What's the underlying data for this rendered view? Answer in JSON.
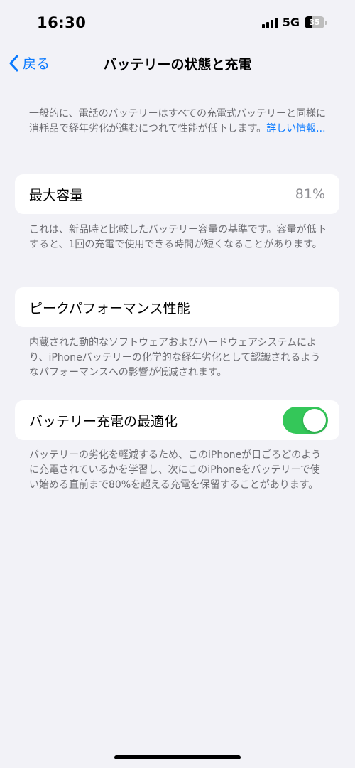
{
  "status_bar": {
    "time": "16:30",
    "network": "5G",
    "battery_level": "35"
  },
  "nav": {
    "back_label": "戻る",
    "title": "バッテリーの状態と充電"
  },
  "intro": {
    "text": "一般的に、電話のバッテリーはすべての充電式バッテリーと同様に消耗品で経年劣化が進むにつれて性能が低下します。",
    "link": "詳しい情報..."
  },
  "max_capacity": {
    "label": "最大容量",
    "value": "81%",
    "footer": "これは、新品時と比較したバッテリー容量の基準です。容量が低下すると、1回の充電で使用できる時間が短くなることがあります。"
  },
  "peak_performance": {
    "label": "ピークパフォーマンス性能",
    "footer": "内蔵された動的なソフトウェアおよびハードウェアシステムにより、iPhoneバッテリーの化学的な経年劣化として認識されるようなパフォーマンスへの影響が低減されます。"
  },
  "optimized_charging": {
    "label": "バッテリー充電の最適化",
    "enabled": true,
    "footer": "バッテリーの劣化を軽減するため、このiPhoneが日ごろどのように充電されているかを学習し、次にこのiPhoneをバッテリーで使い始める直前まで80%を超える充電を保留することがあります。"
  },
  "colors": {
    "accent": "#0a7aff",
    "toggle_on": "#34c759",
    "background": "#f2f2f7"
  }
}
